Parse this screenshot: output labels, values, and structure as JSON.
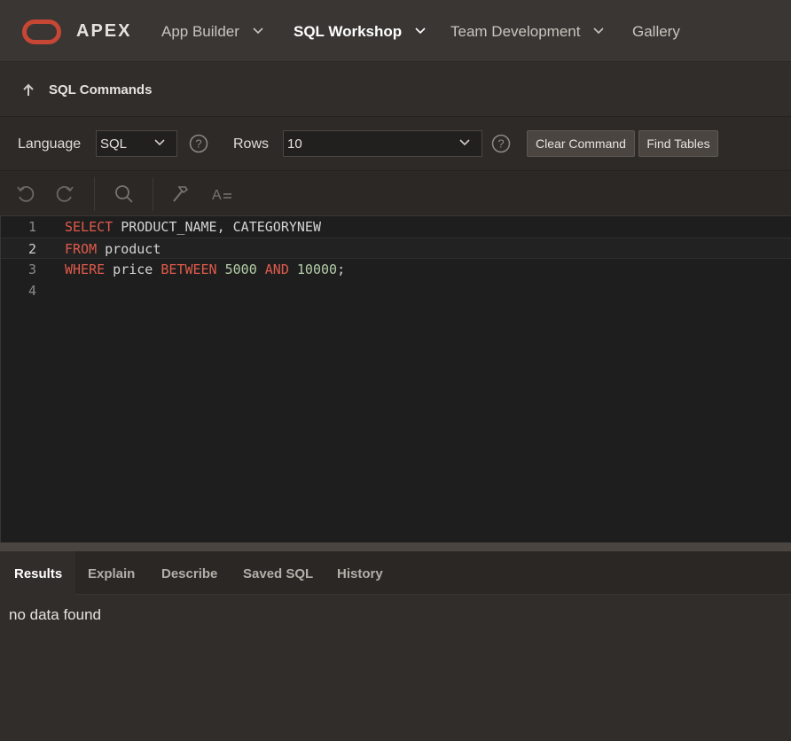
{
  "brand": "APEX",
  "nav": {
    "app_builder": "App Builder",
    "sql_workshop": "SQL Workshop",
    "team_development": "Team Development",
    "gallery": "Gallery"
  },
  "page_title": "SQL Commands",
  "toolbar": {
    "language_label": "Language",
    "language_value": "SQL",
    "rows_label": "Rows",
    "rows_value": "10",
    "clear_command": "Clear Command",
    "find_tables": "Find Tables"
  },
  "editor": {
    "lines": [
      {
        "num": "1",
        "tokens": [
          {
            "t": "SELECT",
            "k": "kw"
          },
          {
            "t": " PRODUCT_NAME, CATEGORYNEW",
            "k": ""
          }
        ]
      },
      {
        "num": "2",
        "tokens": [
          {
            "t": "FROM",
            "k": "kw"
          },
          {
            "t": " product",
            "k": ""
          }
        ]
      },
      {
        "num": "3",
        "tokens": [
          {
            "t": "WHERE",
            "k": "kw"
          },
          {
            "t": " price ",
            "k": ""
          },
          {
            "t": "BETWEEN",
            "k": "kw"
          },
          {
            "t": " ",
            "k": ""
          },
          {
            "t": "5000",
            "k": "num"
          },
          {
            "t": " ",
            "k": ""
          },
          {
            "t": "AND",
            "k": "kw"
          },
          {
            "t": " ",
            "k": ""
          },
          {
            "t": "10000",
            "k": "num"
          },
          {
            "t": ";",
            "k": ""
          }
        ]
      },
      {
        "num": "4",
        "tokens": []
      }
    ],
    "current_line": 2
  },
  "tabs": [
    "Results",
    "Explain",
    "Describe",
    "Saved SQL",
    "History"
  ],
  "active_tab": "Results",
  "results_message": "no data found",
  "colors": {
    "accent": "#c74634",
    "keyword": "#e05a4b",
    "number": "#b5cea8"
  }
}
